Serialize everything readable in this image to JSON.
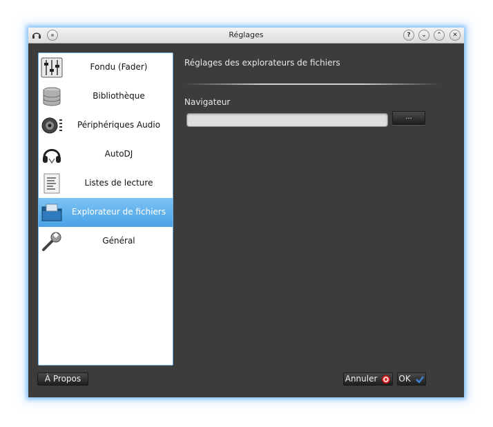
{
  "window": {
    "title": "Réglages"
  },
  "titlebar_icons": [
    "app-headphones-icon",
    "pin-icon",
    "help-icon",
    "minimize-icon",
    "maximize-icon",
    "close-icon"
  ],
  "titlebar_buttons": {
    "help": "?",
    "minimize": "⌄",
    "maximize": "⌃",
    "close": "✕"
  },
  "sidebar": {
    "items": [
      {
        "label": "Fondu (Fader)",
        "icon": "fader-icon"
      },
      {
        "label": "Bibliothèque",
        "icon": "database-icon"
      },
      {
        "label": "Périphériques Audio",
        "icon": "speaker-icon"
      },
      {
        "label": "AutoDJ",
        "icon": "headphones-icon"
      },
      {
        "label": "Listes de lecture",
        "icon": "playlist-document-icon"
      },
      {
        "label": "Explorateur de fichiers",
        "icon": "folder-icon",
        "selected": true
      },
      {
        "label": "Général",
        "icon": "wrench-icon"
      }
    ]
  },
  "content": {
    "heading": "Réglages des explorateurs de fichiers",
    "section_label": "Navigateur",
    "path_value": "",
    "browse_label": "..."
  },
  "footer": {
    "about_label": "À Propos",
    "cancel_label": "Annuler",
    "ok_label": "OK"
  },
  "colors": {
    "window_bg": "#3c3c3c",
    "selection": "#4aa3e6",
    "cancel_icon": "#d83030",
    "ok_icon": "#3b82d6"
  }
}
